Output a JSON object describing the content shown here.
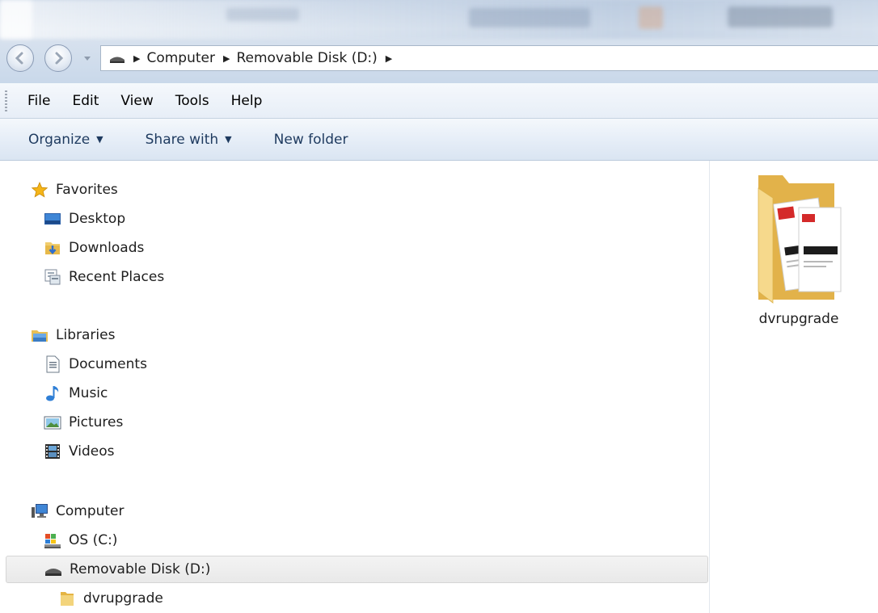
{
  "address_bar": {
    "crumbs": [
      "Computer",
      "Removable Disk (D:)"
    ]
  },
  "menu": {
    "items": [
      "File",
      "Edit",
      "View",
      "Tools",
      "Help"
    ]
  },
  "toolbar": {
    "organize_label": "Organize",
    "share_label": "Share with",
    "new_folder_label": "New folder"
  },
  "nav_pane": {
    "favorites": {
      "label": "Favorites",
      "items": [
        "Desktop",
        "Downloads",
        "Recent Places"
      ]
    },
    "libraries": {
      "label": "Libraries",
      "items": [
        "Documents",
        "Music",
        "Pictures",
        "Videos"
      ]
    },
    "computer": {
      "label": "Computer",
      "items": [
        "OS (C:)",
        "Removable Disk (D:)"
      ],
      "selected": "Removable Disk (D:)",
      "subitems": [
        "dvrupgrade"
      ]
    }
  },
  "content": {
    "files": [
      {
        "name": "dvrupgrade",
        "type": "folder"
      }
    ]
  },
  "colors": {
    "chrome_top": "#c8d5e6",
    "command_text": "#1e3a5f",
    "folder_yellow": "#f2d27a",
    "selection": "#e9e9e9"
  }
}
